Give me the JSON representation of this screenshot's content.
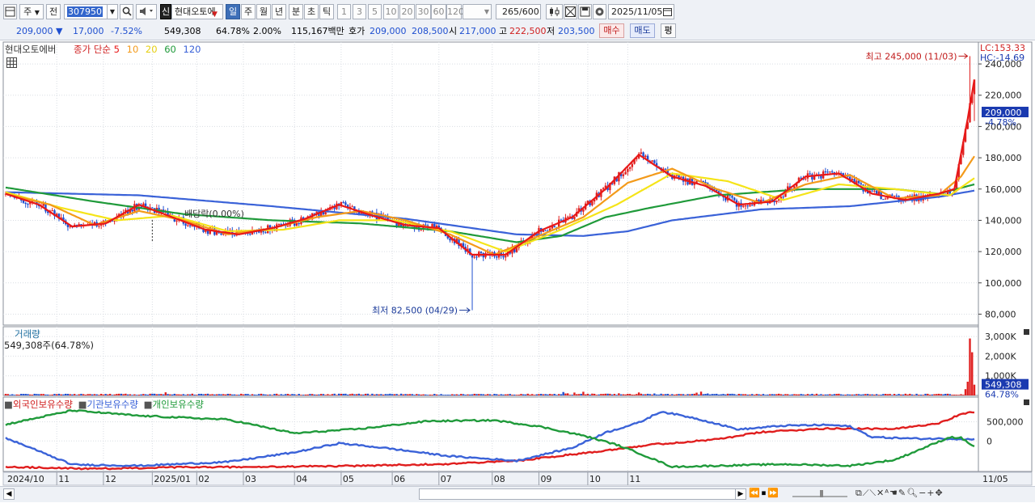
{
  "toolbar": {
    "period_select": "주",
    "prev_label": "전",
    "code_value": "307950",
    "stock_name": "현대오토에",
    "shin_label": "신",
    "period_tabs": [
      "일",
      "주",
      "월",
      "년",
      "분",
      "초",
      "틱"
    ],
    "active_tab": "일",
    "interval_buttons": [
      "1",
      "3",
      "5",
      "10",
      "20",
      "30",
      "60",
      "120"
    ],
    "count_value": "265",
    "count_total": "/600",
    "date_value": "2025/11/05"
  },
  "quote": {
    "price": "209,000",
    "change": "17,000",
    "change_pct": "-7.52%",
    "volume": "549,308",
    "volume_ratio": "64.78%",
    "ratio2": "2.00%",
    "amount": "115,167백만",
    "bid_label": "호가",
    "ask": "209,000",
    "bid": "208,500",
    "open_label": "시",
    "open": "217,000",
    "high_label": "고",
    "high": "222,500",
    "low_label": "저",
    "low": "203,500",
    "buy_label": "매수",
    "sell_label": "매도",
    "eval_label": "평"
  },
  "colors": {
    "up": "#e02020",
    "down": "#1e4fd0",
    "ma5": "#e81818",
    "ma10": "#f39a1a",
    "ma20": "#f5e418",
    "ma60": "#1f9a3a",
    "ma120": "#3a62d8",
    "foreign": "#e01e1e",
    "inst": "#3a62d8",
    "indiv": "#1f9a3a"
  },
  "chart_data": [
    {
      "type": "candlestick",
      "title": "현대오토에버",
      "legend": {
        "label": "종가 단순",
        "periods": [
          "5",
          "10",
          "20",
          "60",
          "120"
        ]
      },
      "lc_label": "LC:153.33",
      "hc_label": "HC:-14.69",
      "ylim": [
        73000,
        254000
      ],
      "y_ticks": [
        "80,000",
        "100,000",
        "120,000",
        "140,000",
        "160,000",
        "180,000",
        "200,000",
        "220,000",
        "240,000"
      ],
      "price_tag": "209,000",
      "price_tag_pct": "-4.78%",
      "annotations": {
        "high": "최고 245,000 (11/03)",
        "low": "최저 82,500 (04/29)",
        "dividend": "배당락(0.00%)"
      },
      "x_labels": [
        "2024/10",
        "11",
        "12",
        "2025/01",
        "02",
        "03",
        "04",
        "05",
        "06",
        "07",
        "08",
        "09",
        "10",
        "11",
        "11/05"
      ],
      "ma_anchors": [
        {
          "period": "5",
          "points": [
            [
              0,
              157000
            ],
            [
              15,
              150000
            ],
            [
              30,
              136000
            ],
            [
              45,
              138000
            ],
            [
              60,
              150000
            ],
            [
              75,
              142000
            ],
            [
              90,
              134000
            ],
            [
              105,
              131000
            ],
            [
              120,
              135000
            ],
            [
              135,
              141000
            ],
            [
              150,
              150000
            ],
            [
              165,
              143000
            ],
            [
              180,
              137000
            ],
            [
              195,
              135000
            ],
            [
              210,
              118000
            ],
            [
              225,
              118000
            ],
            [
              240,
              133000
            ],
            [
              255,
              142000
            ],
            [
              270,
              160000
            ],
            [
              285,
              182000
            ],
            [
              300,
              168000
            ],
            [
              315,
              162000
            ],
            [
              330,
              150000
            ],
            [
              345,
              152000
            ],
            [
              360,
              168000
            ],
            [
              375,
              170000
            ],
            [
              390,
              157000
            ],
            [
              405,
              153000
            ],
            [
              420,
              157000
            ],
            [
              427,
              160000
            ],
            [
              433,
              205000
            ],
            [
              436,
              230000
            ]
          ]
        },
        {
          "period": "10",
          "points": [
            [
              0,
              157000
            ],
            [
              20,
              150000
            ],
            [
              40,
              137000
            ],
            [
              60,
              146000
            ],
            [
              80,
              140000
            ],
            [
              100,
              131000
            ],
            [
              120,
              135000
            ],
            [
              140,
              142000
            ],
            [
              160,
              146000
            ],
            [
              180,
              140000
            ],
            [
              200,
              131000
            ],
            [
              220,
              118000
            ],
            [
              240,
              130000
            ],
            [
              260,
              142000
            ],
            [
              280,
              164000
            ],
            [
              300,
              173000
            ],
            [
              320,
              160000
            ],
            [
              340,
              151000
            ],
            [
              360,
              163000
            ],
            [
              380,
              169000
            ],
            [
              400,
              154000
            ],
            [
              420,
              156000
            ],
            [
              430,
              168000
            ],
            [
              436,
              181000
            ]
          ]
        },
        {
          "period": "20",
          "points": [
            [
              0,
              158000
            ],
            [
              25,
              148000
            ],
            [
              50,
              140000
            ],
            [
              75,
              143000
            ],
            [
              100,
              133000
            ],
            [
              125,
              134000
            ],
            [
              150,
              140000
            ],
            [
              175,
              140000
            ],
            [
              200,
              133000
            ],
            [
              225,
              120000
            ],
            [
              250,
              134000
            ],
            [
              275,
              150000
            ],
            [
              300,
              170000
            ],
            [
              325,
              165000
            ],
            [
              350,
              153000
            ],
            [
              375,
              163000
            ],
            [
              400,
              160000
            ],
            [
              425,
              156000
            ],
            [
              436,
              167000
            ]
          ]
        },
        {
          "period": "60",
          "points": [
            [
              0,
              161000
            ],
            [
              40,
              152000
            ],
            [
              80,
              144000
            ],
            [
              120,
              140000
            ],
            [
              160,
              138000
            ],
            [
              200,
              133000
            ],
            [
              230,
              126000
            ],
            [
              250,
              130000
            ],
            [
              270,
              142000
            ],
            [
              290,
              148000
            ],
            [
              320,
              156000
            ],
            [
              360,
              160000
            ],
            [
              400,
              160000
            ],
            [
              420,
              157000
            ],
            [
              436,
              163000
            ]
          ]
        },
        {
          "period": "120",
          "points": [
            [
              0,
              158000
            ],
            [
              60,
              156000
            ],
            [
              120,
              149000
            ],
            [
              180,
              141000
            ],
            [
              230,
              131000
            ],
            [
              260,
              130000
            ],
            [
              280,
              133000
            ],
            [
              300,
              140000
            ],
            [
              340,
              147000
            ],
            [
              380,
              149000
            ],
            [
              420,
              155000
            ],
            [
              436,
              159000
            ]
          ]
        }
      ]
    },
    {
      "type": "bar",
      "title": "거래량",
      "value_label": "549,308주(64.78%)",
      "y_ticks": [
        "3,000K",
        "2,000K",
        "1,000K"
      ],
      "ylim": [
        0,
        3500
      ],
      "price_tag": "549,308",
      "price_tag_pct": "64.78%"
    },
    {
      "type": "line",
      "legend": [
        "외국인보유수량",
        "기관보유수량",
        "개인보유수량"
      ],
      "y_ticks": [
        "500,000",
        "0"
      ],
      "ylim": [
        -800000,
        1150000
      ],
      "series": [
        {
          "name": "외국인보유수량",
          "anchors": [
            [
              0,
              -680000
            ],
            [
              40,
              -730000
            ],
            [
              80,
              -690000
            ],
            [
              120,
              -680000
            ],
            [
              160,
              -650000
            ],
            [
              200,
              -600000
            ],
            [
              230,
              -520000
            ],
            [
              260,
              -320000
            ],
            [
              290,
              -100000
            ],
            [
              320,
              40000
            ],
            [
              340,
              230000
            ],
            [
              370,
              330000
            ],
            [
              400,
              310000
            ],
            [
              420,
              470000
            ],
            [
              430,
              700000
            ],
            [
              436,
              760000
            ]
          ]
        },
        {
          "name": "기관보유수량",
          "anchors": [
            [
              0,
              80000
            ],
            [
              30,
              -620000
            ],
            [
              60,
              -650000
            ],
            [
              100,
              -550000
            ],
            [
              130,
              -300000
            ],
            [
              150,
              -60000
            ],
            [
              170,
              -180000
            ],
            [
              200,
              -400000
            ],
            [
              230,
              -520000
            ],
            [
              255,
              -180000
            ],
            [
              270,
              220000
            ],
            [
              285,
              480000
            ],
            [
              295,
              770000
            ],
            [
              310,
              600000
            ],
            [
              330,
              300000
            ],
            [
              350,
              400000
            ],
            [
              370,
              420000
            ],
            [
              380,
              380000
            ],
            [
              390,
              100000
            ],
            [
              410,
              60000
            ],
            [
              425,
              60000
            ],
            [
              436,
              40000
            ]
          ]
        },
        {
          "name": "개인보유수량",
          "anchors": [
            [
              0,
              430000
            ],
            [
              30,
              800000
            ],
            [
              60,
              660000
            ],
            [
              100,
              560000
            ],
            [
              130,
              200000
            ],
            [
              160,
              320000
            ],
            [
              190,
              520000
            ],
            [
              220,
              540000
            ],
            [
              240,
              380000
            ],
            [
              260,
              140000
            ],
            [
              275,
              -100000
            ],
            [
              285,
              -320000
            ],
            [
              300,
              -680000
            ],
            [
              320,
              -650000
            ],
            [
              350,
              -610000
            ],
            [
              380,
              -650000
            ],
            [
              400,
              -500000
            ],
            [
              425,
              100000
            ],
            [
              430,
              80000
            ],
            [
              436,
              -150000
            ]
          ]
        }
      ]
    }
  ]
}
